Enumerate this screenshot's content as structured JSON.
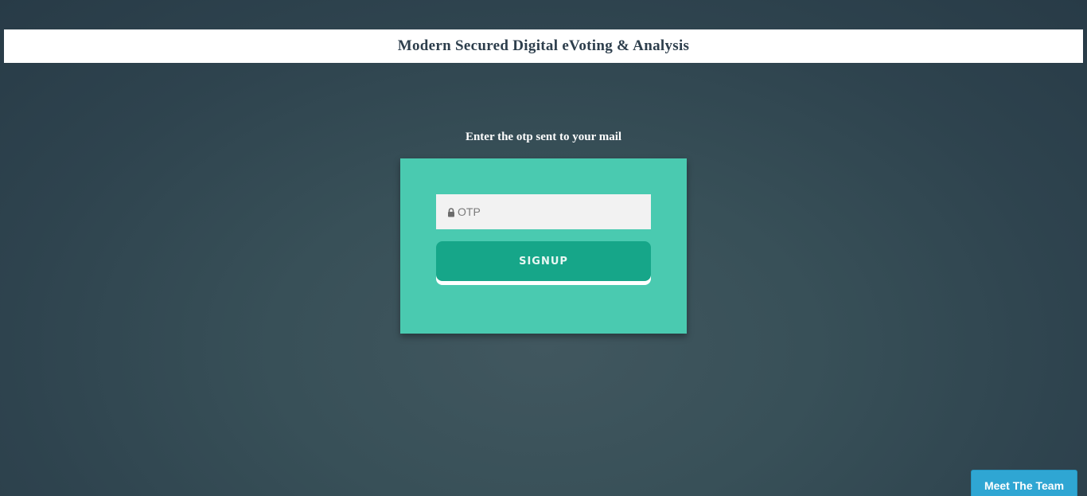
{
  "header": {
    "title": "Modern Secured Digital eVoting & Analysis"
  },
  "otp_form": {
    "instruction": "Enter the otp sent to your mail",
    "otp_placeholder": "OTP",
    "otp_icon": "lock-icon",
    "signup_label": "SIGNUP"
  },
  "footer": {
    "team_button_label": "Meet The Team"
  },
  "colors": {
    "card": "#4acab0",
    "signup_button": "#16a689",
    "team_button": "#2fa6d3",
    "header_text": "#2d3e4c"
  }
}
